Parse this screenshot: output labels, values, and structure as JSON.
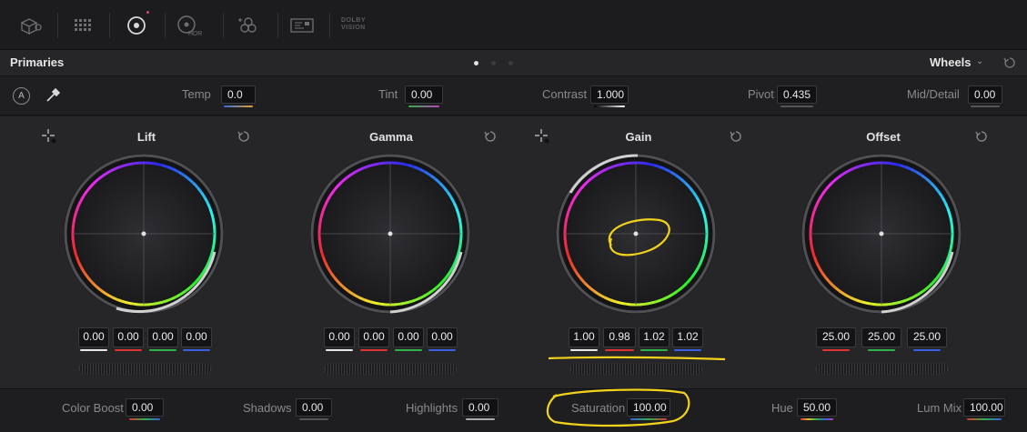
{
  "toolbar": {
    "icons": [
      "camera-raw-icon",
      "color-match-icon",
      "color-wheels-icon",
      "hdr-wheels-icon",
      "rgb-mixer-icon",
      "motion-effects-icon"
    ],
    "hdr_label": "HDR",
    "dolby_line1": "DOLBY",
    "dolby_line2": "VISION"
  },
  "panel": {
    "title": "Primaries",
    "mode": "Wheels",
    "page_dots": 3,
    "active_page": 0
  },
  "adjustments": {
    "auto_label": "A",
    "temp_label": "Temp",
    "temp_value": "0.0",
    "tint_label": "Tint",
    "tint_value": "0.00",
    "contrast_label": "Contrast",
    "contrast_value": "1.000",
    "pivot_label": "Pivot",
    "pivot_value": "0.435",
    "middetail_label": "Mid/Detail",
    "middetail_value": "0.00"
  },
  "wheels": {
    "lift": {
      "title": "Lift",
      "y": "0.00",
      "r": "0.00",
      "g": "0.00",
      "b": "0.00"
    },
    "gamma": {
      "title": "Gamma",
      "y": "0.00",
      "r": "0.00",
      "g": "0.00",
      "b": "0.00"
    },
    "gain": {
      "title": "Gain",
      "y": "1.00",
      "r": "0.98",
      "g": "1.02",
      "b": "1.02"
    },
    "offset": {
      "title": "Offset",
      "r": "25.00",
      "g": "25.00",
      "b": "25.00"
    }
  },
  "bottom": {
    "colorboost_label": "Color Boost",
    "colorboost_value": "0.00",
    "shadows_label": "Shadows",
    "shadows_value": "0.00",
    "highlights_label": "Highlights",
    "highlights_value": "0.00",
    "saturation_label": "Saturation",
    "saturation_value": "100.00",
    "hue_label": "Hue",
    "hue_value": "50.00",
    "lummix_label": "Lum Mix",
    "lummix_value": "100.00"
  },
  "colors": {
    "background": "#1b1b1d",
    "panel": "#262629",
    "field": "#141416",
    "annotation": "#f2d21b",
    "red": "#e03434",
    "green": "#2fb24a",
    "blue": "#3a5fe0",
    "white": "#e8e8e8"
  }
}
